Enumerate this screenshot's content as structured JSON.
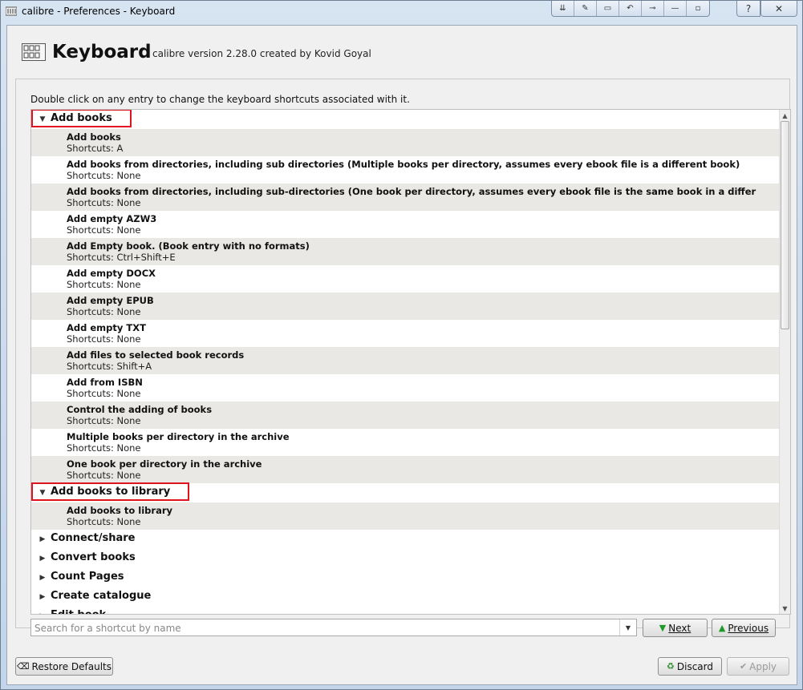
{
  "window": {
    "title": "calibre - Preferences - Keyboard",
    "controls": [
      "pin-icon",
      "tools-icon",
      "window-icon",
      "undo-icon",
      "connect-icon",
      "minimize-icon",
      "restore-icon"
    ],
    "help_label": "?",
    "close_label": "✕"
  },
  "header": {
    "title": "Keyboard",
    "subtitle": "calibre version 2.28.0 created by Kovid Goyal"
  },
  "hint": "Double click on any entry to change the keyboard shortcuts associated with it.",
  "tree": {
    "categories": [
      {
        "label": "Add books",
        "expanded": true,
        "items": [
          {
            "name": "Add books",
            "shortcut": "Shortcuts: A"
          },
          {
            "name": "Add books from directories, including sub directories (Multiple books per directory, assumes every ebook file is a different book)",
            "shortcut": "Shortcuts: None"
          },
          {
            "name": "Add books from directories, including sub-directories (One book per directory, assumes every ebook file is the same book in a differ",
            "shortcut": "Shortcuts: None"
          },
          {
            "name": "Add empty AZW3",
            "shortcut": "Shortcuts: None"
          },
          {
            "name": "Add Empty book. (Book entry with no formats)",
            "shortcut": "Shortcuts: Ctrl+Shift+E"
          },
          {
            "name": "Add empty DOCX",
            "shortcut": "Shortcuts: None"
          },
          {
            "name": "Add empty EPUB",
            "shortcut": "Shortcuts: None"
          },
          {
            "name": "Add empty TXT",
            "shortcut": "Shortcuts: None"
          },
          {
            "name": "Add files to selected book records",
            "shortcut": "Shortcuts: Shift+A"
          },
          {
            "name": "Add from ISBN",
            "shortcut": "Shortcuts: None"
          },
          {
            "name": "Control the adding of books",
            "shortcut": "Shortcuts: None"
          },
          {
            "name": "Multiple books per directory in the archive",
            "shortcut": "Shortcuts: None"
          },
          {
            "name": "One book per directory in the archive",
            "shortcut": "Shortcuts: None"
          }
        ]
      },
      {
        "label": "Add books to library",
        "expanded": true,
        "items": [
          {
            "name": "Add books to library",
            "shortcut": "Shortcuts: None"
          }
        ]
      },
      {
        "label": "Connect/share",
        "expanded": false
      },
      {
        "label": "Convert books",
        "expanded": false
      },
      {
        "label": "Count Pages",
        "expanded": false
      },
      {
        "label": "Create catalogue",
        "expanded": false
      },
      {
        "label": "Edit book",
        "expanded": false
      }
    ]
  },
  "search": {
    "placeholder": "Search for a shortcut by name",
    "value": ""
  },
  "buttons": {
    "next": "Next",
    "previous": "Previous",
    "restore_defaults": "Restore Defaults",
    "discard": "Discard",
    "apply": "Apply"
  },
  "colors": {
    "highlight_box": "#e0141e",
    "alt_row": "#e9e8e4",
    "next_arrow": "#1f9a2a"
  }
}
